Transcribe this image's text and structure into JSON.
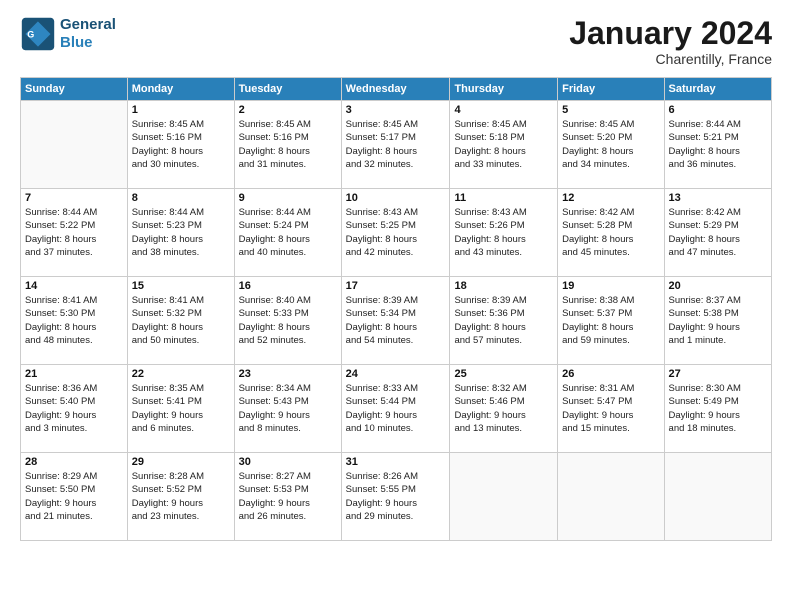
{
  "header": {
    "logo_line1": "General",
    "logo_line2": "Blue",
    "month": "January 2024",
    "location": "Charentilly, France"
  },
  "days_of_week": [
    "Sunday",
    "Monday",
    "Tuesday",
    "Wednesday",
    "Thursday",
    "Friday",
    "Saturday"
  ],
  "weeks": [
    [
      {
        "day": "",
        "info": ""
      },
      {
        "day": "1",
        "info": "Sunrise: 8:45 AM\nSunset: 5:16 PM\nDaylight: 8 hours\nand 30 minutes."
      },
      {
        "day": "2",
        "info": "Sunrise: 8:45 AM\nSunset: 5:16 PM\nDaylight: 8 hours\nand 31 minutes."
      },
      {
        "day": "3",
        "info": "Sunrise: 8:45 AM\nSunset: 5:17 PM\nDaylight: 8 hours\nand 32 minutes."
      },
      {
        "day": "4",
        "info": "Sunrise: 8:45 AM\nSunset: 5:18 PM\nDaylight: 8 hours\nand 33 minutes."
      },
      {
        "day": "5",
        "info": "Sunrise: 8:45 AM\nSunset: 5:20 PM\nDaylight: 8 hours\nand 34 minutes."
      },
      {
        "day": "6",
        "info": "Sunrise: 8:44 AM\nSunset: 5:21 PM\nDaylight: 8 hours\nand 36 minutes."
      }
    ],
    [
      {
        "day": "7",
        "info": "Sunrise: 8:44 AM\nSunset: 5:22 PM\nDaylight: 8 hours\nand 37 minutes."
      },
      {
        "day": "8",
        "info": "Sunrise: 8:44 AM\nSunset: 5:23 PM\nDaylight: 8 hours\nand 38 minutes."
      },
      {
        "day": "9",
        "info": "Sunrise: 8:44 AM\nSunset: 5:24 PM\nDaylight: 8 hours\nand 40 minutes."
      },
      {
        "day": "10",
        "info": "Sunrise: 8:43 AM\nSunset: 5:25 PM\nDaylight: 8 hours\nand 42 minutes."
      },
      {
        "day": "11",
        "info": "Sunrise: 8:43 AM\nSunset: 5:26 PM\nDaylight: 8 hours\nand 43 minutes."
      },
      {
        "day": "12",
        "info": "Sunrise: 8:42 AM\nSunset: 5:28 PM\nDaylight: 8 hours\nand 45 minutes."
      },
      {
        "day": "13",
        "info": "Sunrise: 8:42 AM\nSunset: 5:29 PM\nDaylight: 8 hours\nand 47 minutes."
      }
    ],
    [
      {
        "day": "14",
        "info": "Sunrise: 8:41 AM\nSunset: 5:30 PM\nDaylight: 8 hours\nand 48 minutes."
      },
      {
        "day": "15",
        "info": "Sunrise: 8:41 AM\nSunset: 5:32 PM\nDaylight: 8 hours\nand 50 minutes."
      },
      {
        "day": "16",
        "info": "Sunrise: 8:40 AM\nSunset: 5:33 PM\nDaylight: 8 hours\nand 52 minutes."
      },
      {
        "day": "17",
        "info": "Sunrise: 8:39 AM\nSunset: 5:34 PM\nDaylight: 8 hours\nand 54 minutes."
      },
      {
        "day": "18",
        "info": "Sunrise: 8:39 AM\nSunset: 5:36 PM\nDaylight: 8 hours\nand 57 minutes."
      },
      {
        "day": "19",
        "info": "Sunrise: 8:38 AM\nSunset: 5:37 PM\nDaylight: 8 hours\nand 59 minutes."
      },
      {
        "day": "20",
        "info": "Sunrise: 8:37 AM\nSunset: 5:38 PM\nDaylight: 9 hours\nand 1 minute."
      }
    ],
    [
      {
        "day": "21",
        "info": "Sunrise: 8:36 AM\nSunset: 5:40 PM\nDaylight: 9 hours\nand 3 minutes."
      },
      {
        "day": "22",
        "info": "Sunrise: 8:35 AM\nSunset: 5:41 PM\nDaylight: 9 hours\nand 6 minutes."
      },
      {
        "day": "23",
        "info": "Sunrise: 8:34 AM\nSunset: 5:43 PM\nDaylight: 9 hours\nand 8 minutes."
      },
      {
        "day": "24",
        "info": "Sunrise: 8:33 AM\nSunset: 5:44 PM\nDaylight: 9 hours\nand 10 minutes."
      },
      {
        "day": "25",
        "info": "Sunrise: 8:32 AM\nSunset: 5:46 PM\nDaylight: 9 hours\nand 13 minutes."
      },
      {
        "day": "26",
        "info": "Sunrise: 8:31 AM\nSunset: 5:47 PM\nDaylight: 9 hours\nand 15 minutes."
      },
      {
        "day": "27",
        "info": "Sunrise: 8:30 AM\nSunset: 5:49 PM\nDaylight: 9 hours\nand 18 minutes."
      }
    ],
    [
      {
        "day": "28",
        "info": "Sunrise: 8:29 AM\nSunset: 5:50 PM\nDaylight: 9 hours\nand 21 minutes."
      },
      {
        "day": "29",
        "info": "Sunrise: 8:28 AM\nSunset: 5:52 PM\nDaylight: 9 hours\nand 23 minutes."
      },
      {
        "day": "30",
        "info": "Sunrise: 8:27 AM\nSunset: 5:53 PM\nDaylight: 9 hours\nand 26 minutes."
      },
      {
        "day": "31",
        "info": "Sunrise: 8:26 AM\nSunset: 5:55 PM\nDaylight: 9 hours\nand 29 minutes."
      },
      {
        "day": "",
        "info": ""
      },
      {
        "day": "",
        "info": ""
      },
      {
        "day": "",
        "info": ""
      }
    ]
  ]
}
